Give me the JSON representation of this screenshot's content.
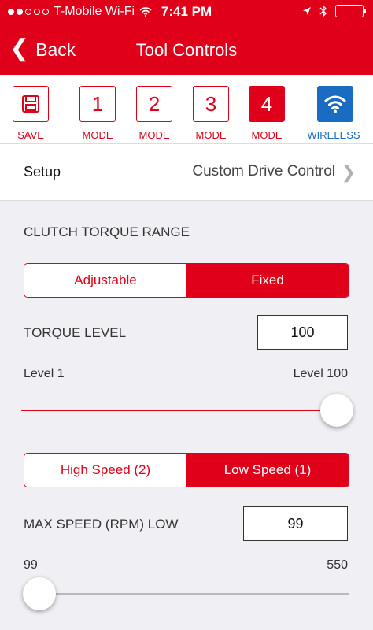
{
  "status": {
    "carrier": "T-Mobile Wi-Fi",
    "time": "7:41 PM"
  },
  "nav": {
    "back_label": "Back",
    "title": "Tool Controls"
  },
  "modes": {
    "save_label": "SAVE",
    "mode1_num": "1",
    "mode2_num": "2",
    "mode3_num": "3",
    "mode4_num": "4",
    "mode_label": "MODE",
    "wireless_label": "WIRELESS",
    "active_mode": "4"
  },
  "setup": {
    "label": "Setup",
    "value": "Custom Drive Control"
  },
  "clutch": {
    "title": "CLUTCH TORQUE RANGE",
    "options": [
      "Adjustable",
      "Fixed"
    ],
    "selected": "Fixed"
  },
  "torque": {
    "label": "TORQUE LEVEL",
    "value": "100",
    "min_label": "Level 1",
    "max_label": "Level 100",
    "slider_fraction": 1.0
  },
  "speed": {
    "options": [
      "High Speed (2)",
      "Low Speed (1)"
    ],
    "selected": "Low Speed (1)",
    "label": "MAX SPEED (RPM) LOW",
    "value": "99",
    "min_label": "99",
    "max_label": "550",
    "slider_fraction": 0.0
  },
  "colors": {
    "brand_red": "#e1001a",
    "wireless_blue": "#1a6cc2",
    "background": "#efeff4"
  }
}
